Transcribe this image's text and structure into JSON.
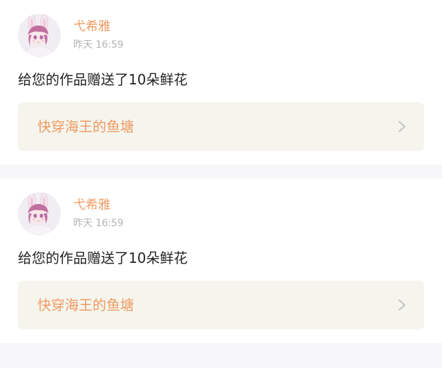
{
  "feed": {
    "items": [
      {
        "user": {
          "name": "弋希雅",
          "avatar_icon": "anime-avatar-icon"
        },
        "time": "昨天 16:59",
        "message": "给您的作品赠送了10朵鲜花",
        "work": {
          "title": "快穿海王的鱼塘",
          "chevron_icon": "chevron-right-icon"
        }
      },
      {
        "user": {
          "name": "弋希雅",
          "avatar_icon": "anime-avatar-icon"
        },
        "time": "昨天 16:59",
        "message": "给您的作品赠送了10朵鲜花",
        "work": {
          "title": "快穿海王的鱼塘",
          "chevron_icon": "chevron-right-icon"
        }
      }
    ]
  },
  "colors": {
    "accent": "#ef9a62",
    "page_background": "#f7f6f8",
    "card_background": "#ffffff",
    "work_box_background": "#f5f5ee",
    "secondary_text": "#b3b3b3",
    "primary_text": "#222222"
  }
}
